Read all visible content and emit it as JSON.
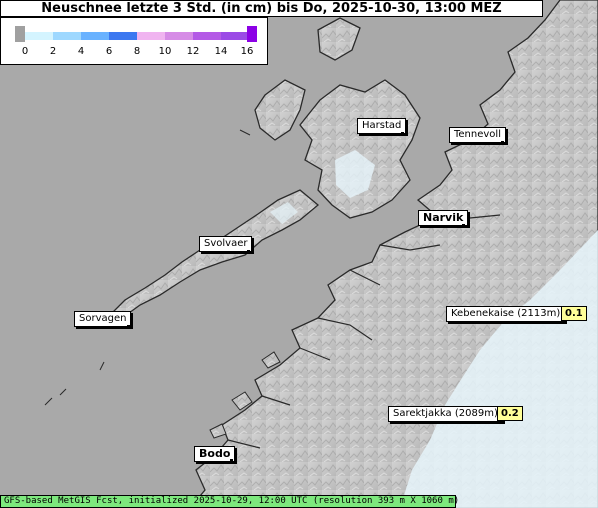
{
  "title": "Neuschnee letzte 3 Std. (in cm) bis Do, 2025-10-30, 13:00 MEZ",
  "legend": {
    "ticks": [
      "0",
      "2",
      "4",
      "6",
      "8",
      "10",
      "12",
      "14",
      "16"
    ],
    "colors": [
      "#a0a0a0",
      "#d4f4ff",
      "#9ed8ff",
      "#69b2ff",
      "#3c78f0",
      "#f0b4f0",
      "#d68ce6",
      "#b45ae6",
      "#8c00e6"
    ]
  },
  "cities": [
    {
      "name": "Harstad",
      "bold": false
    },
    {
      "name": "Tennevoll",
      "bold": false
    },
    {
      "name": "Narvik",
      "bold": true
    },
    {
      "name": "Svolvaer",
      "bold": false
    },
    {
      "name": "Sorvagen",
      "bold": false
    },
    {
      "name": "Kebenekaise (2113m)",
      "bold": false,
      "value": "0.1"
    },
    {
      "name": "Sarektjakka (2089m)",
      "bold": false,
      "value": "0.2"
    },
    {
      "name": "Bodo",
      "bold": true
    }
  ],
  "footer": "GFS-based MetGIS Fcst, initialized 2025-10-29, 12:00 UTC  (resolution 393 m X 1060 m)",
  "colors": {
    "sea": "#a9a9a9",
    "land": "#c9c9c9",
    "snow_cover": "#e6f4fa",
    "footer_bg": "#7de87d",
    "value_bg": "#ffff99"
  }
}
